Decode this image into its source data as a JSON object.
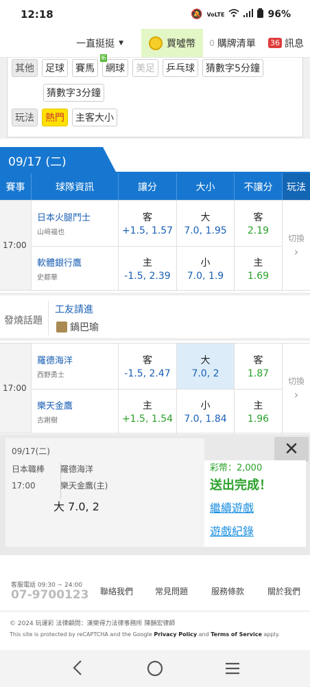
{
  "status": {
    "time": "12:18",
    "battery": "96%",
    "net": "VoLTE"
  },
  "topnav": {
    "selector": "一直挺挺",
    "buy": "買噓幣",
    "cart_count": "0",
    "cart": "購牌清單",
    "msg_count": "36",
    "msg": "訊息"
  },
  "filters": {
    "other_label": "其他",
    "other": [
      "足球",
      "賽馬",
      "網球",
      "美足",
      "乒乓球",
      "猜數字5分鐘",
      "猜數字3分鐘"
    ],
    "play_label": "玩法",
    "plays": [
      "熱門",
      "主客大小"
    ]
  },
  "date": "09/17 (二)",
  "headers": [
    "賽事",
    "球隊資訊",
    "讓分",
    "大小",
    "不讓分",
    "玩法"
  ],
  "matches": [
    {
      "time": "17:00",
      "switch": "切換",
      "rows": [
        {
          "team": "日本火腿鬥士",
          "pitcher": "山﨑福也",
          "spread_side": "客",
          "spread_odd": "+1.5, 1.57",
          "ou_side": "大",
          "ou_odd": "7.0, 1.95",
          "ml_side": "客",
          "ml_odd": "2.19"
        },
        {
          "team": "軟體銀行鷹",
          "pitcher": "史都華",
          "spread_side": "主",
          "spread_odd": "-1.5, 2.39",
          "ou_side": "小",
          "ou_odd": "7.0, 1.9",
          "ml_side": "主",
          "ml_odd": "1.69"
        }
      ]
    },
    {
      "time": "17:00",
      "switch": "切換",
      "rows": [
        {
          "team": "羅德海洋",
          "pitcher": "西野勇士",
          "spread_side": "客",
          "spread_odd": "-1.5, 2.47",
          "ou_side": "大",
          "ou_odd": "7.0, 2",
          "ml_side": "客",
          "ml_odd": "1.87"
        },
        {
          "team": "樂天金鷹",
          "pitcher": "古謝樹",
          "spread_side": "主",
          "spread_odd": "+1.5, 1.54",
          "ou_side": "小",
          "ou_odd": "7.0, 1.84",
          "ml_side": "主",
          "ml_odd": "1.96"
        }
      ]
    }
  ],
  "topic": {
    "label": "發燒話題",
    "title": "工友請進",
    "author": "鍋巴瑜"
  },
  "popup": {
    "date": "09/17(二)",
    "league": "日本職棒",
    "time": "17:00",
    "away": "羅德海洋",
    "home": "樂天金鷹(主)",
    "pick": "大 7.0, 2",
    "coins": "彩幣：2,000",
    "done": "送出完成！",
    "continue": "繼續遊戲",
    "record": "遊戲紀錄"
  },
  "footer": {
    "hours": "客服電話 09:30 ~ 24:00",
    "phone": "07-9700123",
    "links": [
      "聯絡我們",
      "常見問題",
      "服務條款",
      "關於我們"
    ],
    "copyright": "© 2024 玩運彩 法律顧問：漢榮得力法律事務所 陳韻宏律師",
    "recaptcha": "This site is protected by reCAPTCHA and the Google",
    "privacy": "Privacy Policy",
    "and": "and",
    "terms": "Terms of Service",
    "apply": "apply."
  },
  "colors": {
    "primary": "#1777d0",
    "green_odds": "#2aa12a",
    "link": "#1a5fb4",
    "hot": "#ffe100",
    "highlight": "#dcedf9"
  }
}
